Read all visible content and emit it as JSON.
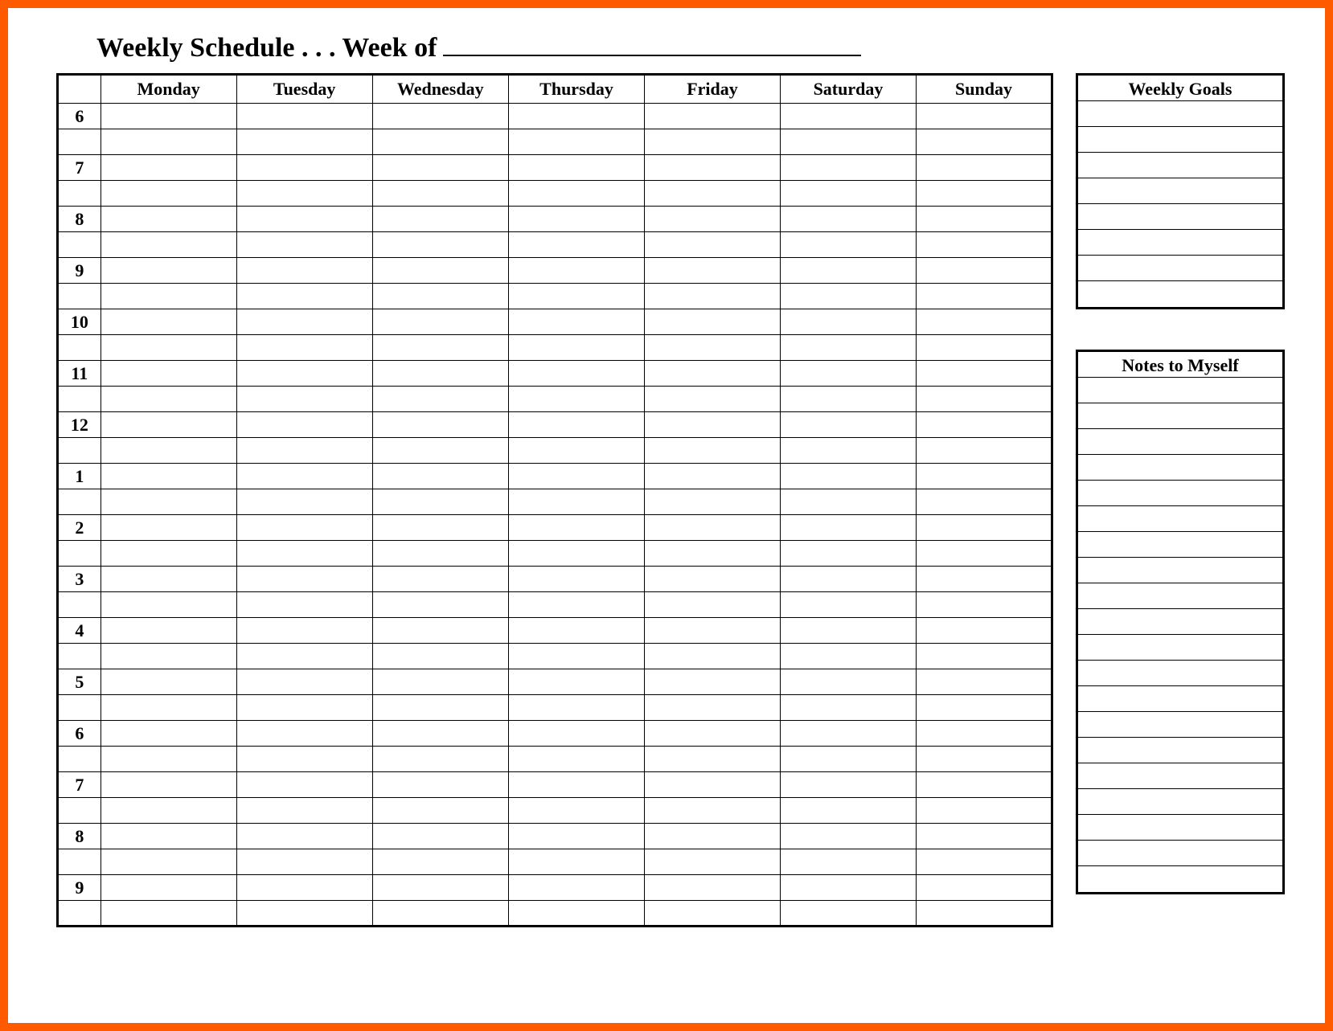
{
  "header": {
    "title": "Weekly Schedule . . . Week of",
    "week_of_value": ""
  },
  "schedule": {
    "time_header": "",
    "days": [
      "Monday",
      "Tuesday",
      "Wednesday",
      "Thursday",
      "Friday",
      "Saturday",
      "Sunday"
    ],
    "hours": [
      "6",
      "7",
      "8",
      "9",
      "10",
      "11",
      "12",
      "1",
      "2",
      "3",
      "4",
      "5",
      "6",
      "7",
      "8",
      "9"
    ],
    "cells": {}
  },
  "goals": {
    "title": "Weekly Goals",
    "lines": [
      "",
      "",
      "",
      "",
      "",
      "",
      "",
      ""
    ]
  },
  "notes": {
    "title": "Notes to Myself",
    "lines": [
      "",
      "",
      "",
      "",
      "",
      "",
      "",
      "",
      "",
      "",
      "",
      "",
      "",
      "",
      "",
      "",
      "",
      "",
      "",
      ""
    ]
  }
}
